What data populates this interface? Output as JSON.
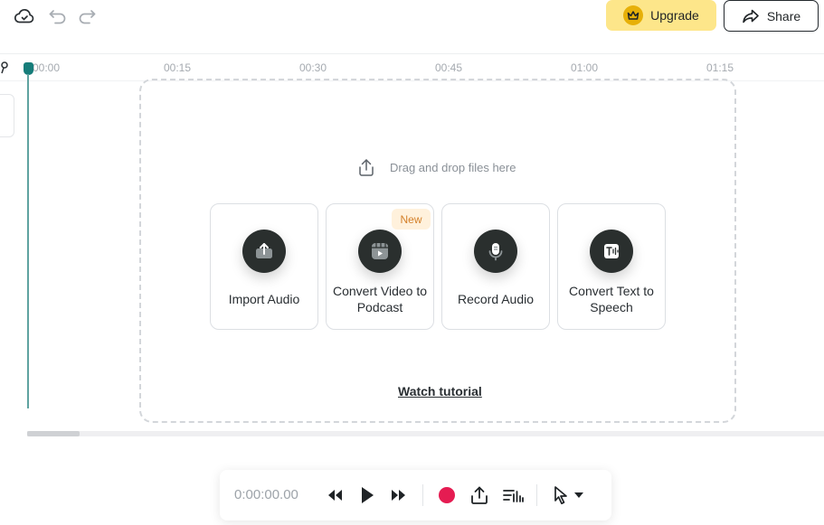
{
  "topbar": {
    "icons": [
      "cloud-sync-icon",
      "undo-icon",
      "redo-icon"
    ],
    "upgrade_label": "Upgrade",
    "share_label": "Share"
  },
  "timeline": {
    "ticks": [
      "00:00",
      "00:15",
      "00:30",
      "00:45",
      "01:00",
      "01:15"
    ]
  },
  "dropzone": {
    "hint": "Drag and drop files here",
    "cards": [
      {
        "label": "Import Audio",
        "icon": "upload-icon"
      },
      {
        "label": "Convert Video to Podcast",
        "icon": "video-icon",
        "badge": "New"
      },
      {
        "label": "Record Audio",
        "icon": "microphone-icon"
      },
      {
        "label": "Convert Text to Speech",
        "icon": "text-to-speech-icon"
      }
    ],
    "watch_tutorial": "Watch tutorial"
  },
  "player": {
    "timecode": "0:00:00.00",
    "controls": [
      "rewind-icon",
      "play-icon",
      "fast-forward-icon",
      "record-icon",
      "export-icon",
      "waveform-icon",
      "cursor-icon",
      "chevron-down-icon"
    ]
  },
  "colors": {
    "accent_teal": "#167d7a",
    "upgrade_bg": "#fde68a",
    "record_red": "#e51c52",
    "badge_orange": "#d4802a"
  }
}
